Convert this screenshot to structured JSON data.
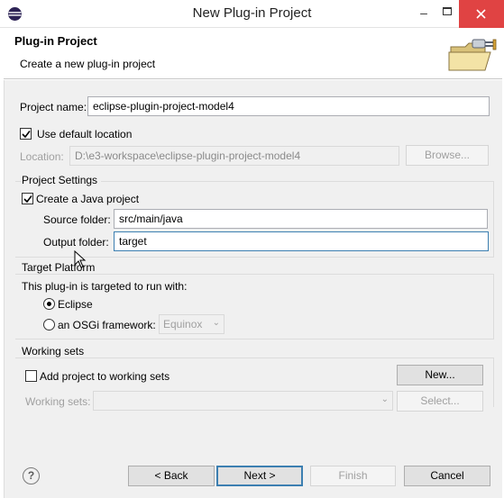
{
  "window": {
    "title": "New Plug-in Project",
    "minimize_glyph": "–"
  },
  "header": {
    "title": "Plug-in Project",
    "description": "Create a new plug-in project"
  },
  "project_name": {
    "label": "Project name:",
    "value": "eclipse-plugin-project-model4"
  },
  "default_location": {
    "checkbox_label": "Use default location",
    "checked": true,
    "location_label": "Location:",
    "location_value": "D:\\e3-workspace\\eclipse-plugin-project-model4",
    "browse_label": "Browse..."
  },
  "project_settings": {
    "group_title": "Project Settings",
    "java_checkbox_label": "Create a Java project",
    "java_checked": true,
    "source_label": "Source folder:",
    "source_value": "src/main/java",
    "output_label": "Output folder:",
    "output_value": "target"
  },
  "target_platform": {
    "group_title": "Target Platform",
    "description": "This plug-in is targeted to run with:",
    "options": [
      {
        "label": "Eclipse",
        "selected": true
      },
      {
        "label": "an OSGi framework:",
        "selected": false
      }
    ],
    "framework_select": "Equinox"
  },
  "working_sets": {
    "group_title": "Working sets",
    "checkbox_label": "Add project to working sets",
    "checked": false,
    "new_button": "New...",
    "sets_label": "Working sets:",
    "select_button": "Select..."
  },
  "footer": {
    "help_glyph": "?",
    "back_label": "< Back",
    "next_label": "Next >",
    "finish_label": "Finish",
    "cancel_label": "Cancel"
  },
  "colors": {
    "close_button": "#e04343",
    "focus_border": "#3c7fb1",
    "dialog_bg": "#f0f0f0"
  },
  "icons": [
    "eclipse-logo-icon",
    "wizard-folder-plug-icon",
    "help-icon",
    "mouse-cursor-icon",
    "checkmark-icon"
  ]
}
